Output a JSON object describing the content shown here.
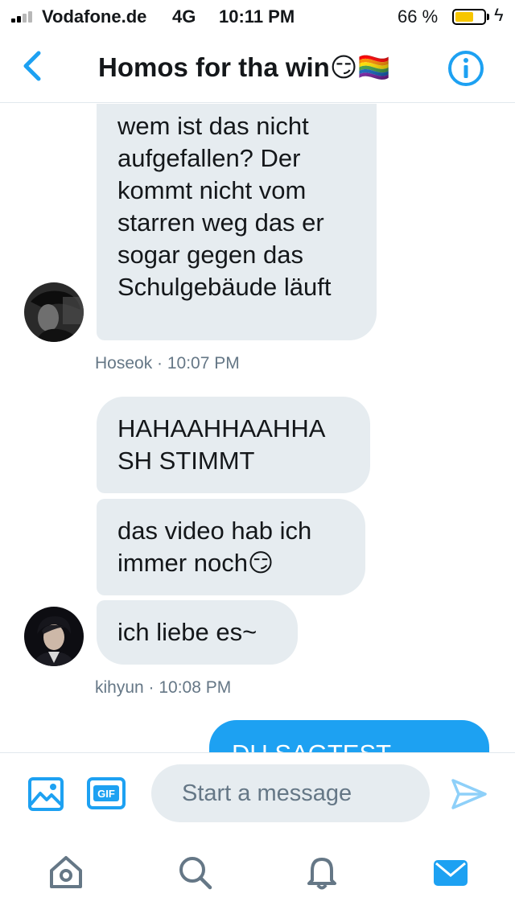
{
  "status_bar": {
    "carrier": "Vodafone.de",
    "network": "4G",
    "time": "10:11 PM",
    "battery_percent": "66 %",
    "battery_level": 0.66,
    "charging_icon": "lightning-icon"
  },
  "header": {
    "title": "Homos for tha win😏🏳️‍🌈",
    "back_icon": "chevron-left-icon",
    "info_icon": "info-icon"
  },
  "messages": [
    {
      "text": "wem ist das nicht aufgefallen? Der kommt nicht vom starren weg das er sogar gegen das Schulgebäude läuft",
      "outgoing": false
    },
    {
      "meta": "Hoseok · 10:07 PM"
    },
    {
      "text": "HAHAAHHAAHHA SH STIMMT",
      "outgoing": false
    },
    {
      "text": "das video hab ich immer noch😏",
      "outgoing": false
    },
    {
      "text": "ich liebe es~",
      "outgoing": false
    },
    {
      "meta": "kihyun · 10:08 PM"
    },
    {
      "text": "DU SAGTEST",
      "outgoing": true
    }
  ],
  "composer": {
    "placeholder": "Start a message",
    "gif_label": "GIF",
    "media_icon": "image-icon",
    "send_icon": "send-icon"
  },
  "tab_bar": {
    "tabs": [
      {
        "icon": "home-icon",
        "active": false
      },
      {
        "icon": "search-icon",
        "active": false
      },
      {
        "icon": "bell-icon",
        "active": false
      },
      {
        "icon": "mail-icon",
        "active": true
      }
    ]
  },
  "colors": {
    "accent": "#1da1f2",
    "incoming_bubble": "#e6ecf0",
    "secondary_text": "#657786",
    "battery": "#f7c600"
  }
}
